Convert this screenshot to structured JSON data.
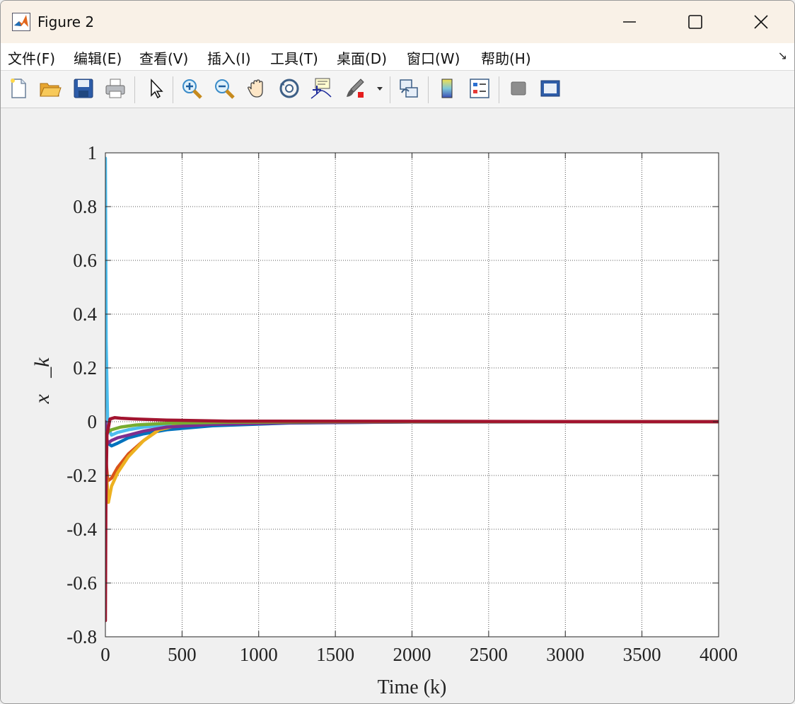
{
  "window": {
    "title": "Figure 2",
    "icons": {
      "app": "matlab-icon",
      "minimize": "minimize-icon",
      "maximize": "maximize-icon",
      "close": "close-icon"
    }
  },
  "menubar": {
    "items": [
      {
        "label": "文件(F)"
      },
      {
        "label": "编辑(E)"
      },
      {
        "label": "查看(V)"
      },
      {
        "label": "插入(I)"
      },
      {
        "label": "工具(T)"
      },
      {
        "label": "桌面(D)"
      },
      {
        "label": "窗口(W)"
      },
      {
        "label": "帮助(H)"
      }
    ],
    "dock_icon": "dock-arrow-icon"
  },
  "toolbar": {
    "buttons": [
      "new-figure-icon",
      "open-file-icon",
      "save-icon",
      "print-icon",
      "edit-plot-icon",
      "zoom-in-icon",
      "zoom-out-icon",
      "pan-icon",
      "rotate-3d-icon",
      "data-cursor-icon",
      "brush-icon",
      "link-plot-icon",
      "colorbar-icon",
      "legend-icon",
      "hide-plot-tools-icon",
      "show-plot-tools-icon"
    ]
  },
  "chart_data": {
    "type": "line",
    "title": "",
    "xlabel": "Time (k)",
    "ylabel": "x⃗_k",
    "xlim": [
      0,
      4000
    ],
    "ylim": [
      -0.8,
      1
    ],
    "xticks": [
      "0",
      "500",
      "1000",
      "1500",
      "2000",
      "2500",
      "3000",
      "3500",
      "4000"
    ],
    "yticks": [
      "1",
      "0.8",
      "0.6",
      "0.4",
      "0.2",
      "0",
      "-0.2",
      "-0.4",
      "-0.6",
      "-0.8"
    ],
    "grid": true,
    "series": [
      {
        "color": "#4dbeee",
        "x": [
          0,
          5,
          15,
          40,
          80,
          150,
          250,
          400,
          700,
          1200,
          2000,
          4000
        ],
        "y": [
          0.98,
          0.3,
          -0.02,
          -0.05,
          -0.04,
          -0.03,
          -0.02,
          -0.012,
          -0.005,
          -0.002,
          0,
          0
        ]
      },
      {
        "color": "#0072bd",
        "x": [
          0,
          5,
          15,
          40,
          80,
          150,
          250,
          400,
          700,
          1200,
          2000,
          4000
        ],
        "y": [
          -0.21,
          -0.08,
          -0.08,
          -0.09,
          -0.08,
          -0.06,
          -0.045,
          -0.03,
          -0.015,
          -0.005,
          -0.001,
          0
        ]
      },
      {
        "color": "#d95319",
        "x": [
          0,
          5,
          15,
          40,
          80,
          150,
          250,
          350,
          500,
          800,
          1500,
          4000
        ],
        "y": [
          -0.18,
          -0.15,
          -0.22,
          -0.21,
          -0.17,
          -0.12,
          -0.07,
          -0.03,
          -0.01,
          -0.003,
          0,
          0
        ]
      },
      {
        "color": "#edb120",
        "x": [
          0,
          5,
          20,
          40,
          80,
          150,
          250,
          350,
          500,
          800,
          1500,
          4000
        ],
        "y": [
          -0.05,
          -0.18,
          -0.3,
          -0.24,
          -0.19,
          -0.13,
          -0.07,
          -0.03,
          -0.01,
          -0.003,
          0,
          0
        ]
      },
      {
        "color": "#7e2f8e",
        "x": [
          0,
          5,
          15,
          40,
          80,
          150,
          250,
          400,
          700,
          1200,
          2000,
          4000
        ],
        "y": [
          0,
          -0.05,
          -0.08,
          -0.07,
          -0.06,
          -0.05,
          -0.035,
          -0.02,
          -0.01,
          -0.004,
          -0.001,
          0
        ]
      },
      {
        "color": "#77ac30",
        "x": [
          0,
          10,
          40,
          100,
          200,
          400,
          800,
          1500,
          4000
        ],
        "y": [
          -0.05,
          -0.04,
          -0.03,
          -0.02,
          -0.012,
          -0.006,
          -0.002,
          0,
          0
        ]
      },
      {
        "color": "#a2142f",
        "x": [
          0,
          3,
          10,
          30,
          60,
          100,
          200,
          400,
          800,
          4000
        ],
        "y": [
          -0.74,
          -0.3,
          -0.05,
          0.01,
          0.015,
          0.013,
          0.01,
          0.006,
          0.002,
          0
        ]
      }
    ]
  }
}
